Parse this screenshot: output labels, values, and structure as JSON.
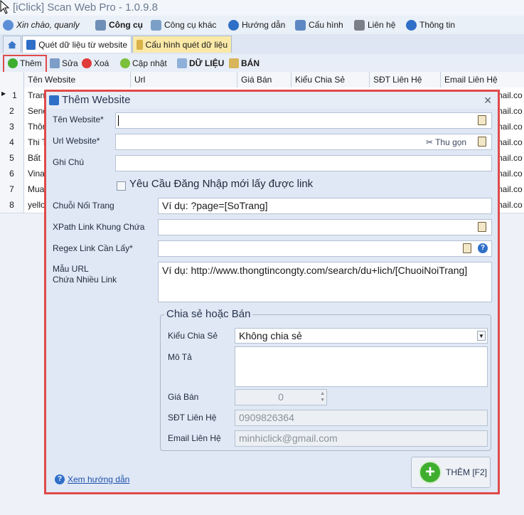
{
  "window": {
    "title": "[iClick] Scan Web Pro - 1.0.9.8"
  },
  "menu": {
    "greeting": "Xin chào, quanly",
    "items": [
      "Công cụ",
      "Công cụ khác",
      "Hướng dẫn",
      "Cấu hình",
      "Liên hệ",
      "Thông tin"
    ]
  },
  "tabs": [
    "Quét dữ liệu từ website",
    "Cấu hình quét dữ liệu"
  ],
  "toolbar": {
    "add": "Thêm",
    "edit": "Sửa",
    "delete": "Xoá",
    "update": "Cập nhật",
    "data": "DỮ LIỆU",
    "sell": "BÁN"
  },
  "grid": {
    "columns": [
      "Tên Website",
      "Url",
      "Giá Bán",
      "Kiểu Chia Sẻ",
      "SĐT Liên Hệ",
      "Email Liên Hệ"
    ],
    "rows": [
      {
        "num": "1",
        "name": "Tran",
        "email": "nail.co"
      },
      {
        "num": "2",
        "name": "Send",
        "email": "nail.co"
      },
      {
        "num": "3",
        "name": "Thôn",
        "email": "nail.co"
      },
      {
        "num": "4",
        "name": "Thi T",
        "email": "nail.co"
      },
      {
        "num": "5",
        "name": "Bất",
        "email": "nail.co"
      },
      {
        "num": "6",
        "name": "Vina",
        "email": "nail.co"
      },
      {
        "num": "7",
        "name": "Mua",
        "email": "nail.co"
      },
      {
        "num": "8",
        "name": "yello",
        "email": "nail.co"
      }
    ]
  },
  "dialog": {
    "title": "Thêm Website",
    "close": "✕",
    "labels": {
      "site_name": "Tên Website*",
      "site_url": "Url Website*",
      "note": "Ghi Chú",
      "login_required": "Yêu Cầu Đăng Nhập mới lấy được link",
      "page_string": "Chuỗi Nối Trang",
      "xpath": "XPath Link Khung Chứa",
      "regex": "Regex Link Cần Lấy*",
      "url_pattern_1": "Mẫu URL",
      "url_pattern_2": "Chứa Nhiều Link"
    },
    "collapse": "Thu gọn",
    "values": {
      "site_name": "",
      "site_url": "",
      "note": "",
      "page_string": "Ví dụ: ?page=[SoTrang]",
      "xpath": "",
      "regex": "",
      "url_pattern": "Ví dụ: http://www.thongtincongty.com/search/du+lich/[ChuoiNoiTrang]"
    },
    "share": {
      "group_title": "Chia sẻ hoặc Bán",
      "type_label": "Kiểu Chia Sẻ",
      "type_value": "Không chia sẻ",
      "desc_label": "Mô Tả",
      "price_label": "Giá Bán",
      "price_value": "0",
      "phone_label": "SĐT Liên Hệ",
      "phone_value": "0909826364",
      "email_label": "Email Liên Hệ",
      "email_value": "minhiclick@gmail.com"
    },
    "help_link": "Xem hướng dẫn",
    "add_button": "THÊM [F2]"
  }
}
